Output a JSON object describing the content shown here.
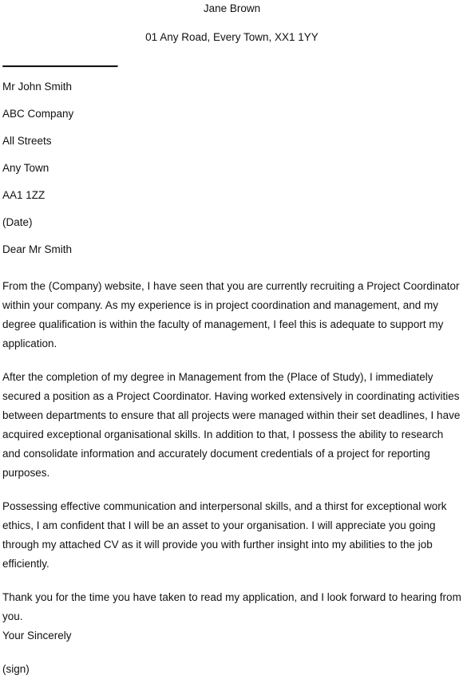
{
  "document": {
    "type": "cover-letter",
    "text_color": "#111111",
    "background_color": "#ffffff",
    "sender": {
      "name": "Jane Brown",
      "address": "01 Any Road, Every Town, XX1 1YY"
    },
    "divider": {
      "label": "horizontal-rule"
    },
    "recipient": {
      "lines": [
        "Mr John Smith",
        "ABC Company",
        "All Streets",
        "Any Town",
        "AA1 1ZZ",
        "(Date)"
      ]
    },
    "salutation": "Dear Mr Smith",
    "paragraphs": [
      "From the (Company) website, I have seen that you are currently recruiting a Project Coordinator within your company. As my experience is in project coordination and management, and my degree qualification is within the faculty of management, I feel this is adequate to support my application.",
      "After the completion of my degree in Management from the (Place of Study), I immediately secured a position as a Project Coordinator. Having worked extensively in coordinating activities between departments to ensure that all projects were managed within their set deadlines, I have acquired exceptional organisational skills. In addition to that, I possess the ability to research and consolidate information and accurately document credentials of a project for reporting purposes.",
      "Possessing effective communication and interpersonal skills, and a thirst for exceptional work ethics, I am confident that I will be an asset to your organisation. I will appreciate you going through my attached CV as it will provide you with further insight into my abilities to the job efficiently.",
      "Thank you for the time you have taken to read my application, and I look forward to hearing from you."
    ],
    "closing": "Your Sincerely",
    "signature_placeholder": "(sign)"
  }
}
